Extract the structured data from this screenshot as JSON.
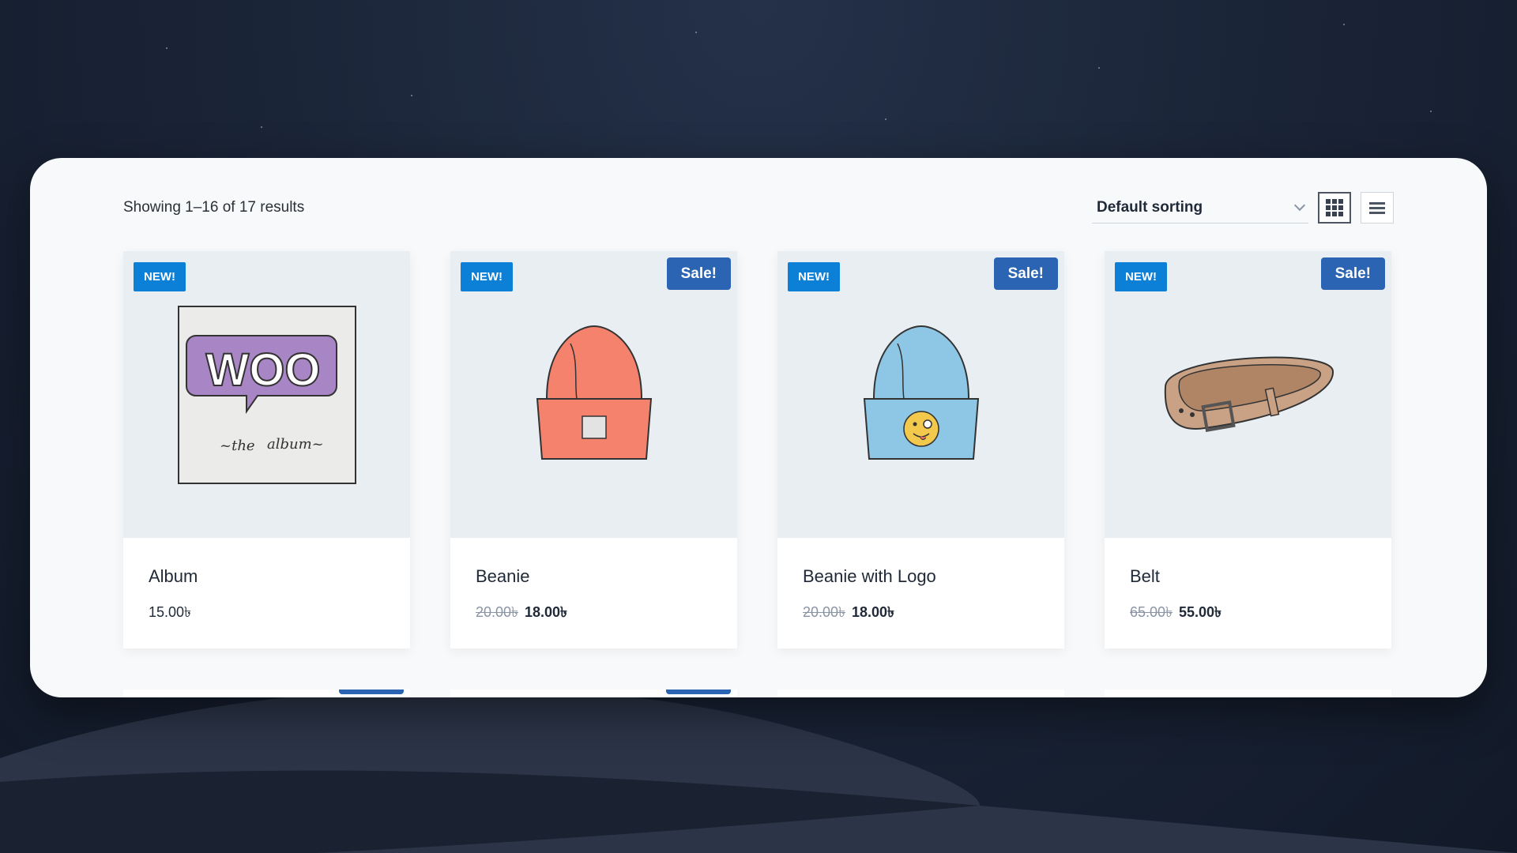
{
  "toolbar": {
    "result_count": "Showing 1–16 of 17 results",
    "sort_selected": "Default sorting",
    "grid_view_icon": "grid-icon",
    "list_view_icon": "list-icon"
  },
  "colors": {
    "new_badge": "#0c7fd6",
    "sale_badge": "#2a64b2",
    "image_bg": "#e8eef2"
  },
  "products": [
    {
      "name": "Album",
      "price": "15.00৳",
      "old_price": "",
      "new_badge": "NEW!",
      "sale_badge": "",
      "image": "woo-album-illustration"
    },
    {
      "name": "Beanie",
      "price": "18.00৳",
      "old_price": "20.00৳",
      "new_badge": "NEW!",
      "sale_badge": "Sale!",
      "image": "orange-beanie-illustration"
    },
    {
      "name": "Beanie with Logo",
      "price": "18.00৳",
      "old_price": "20.00৳",
      "new_badge": "NEW!",
      "sale_badge": "Sale!",
      "image": "blue-beanie-logo-illustration"
    },
    {
      "name": "Belt",
      "price": "55.00৳",
      "old_price": "65.00৳",
      "new_badge": "NEW!",
      "sale_badge": "Sale!",
      "image": "belt-illustration"
    }
  ]
}
